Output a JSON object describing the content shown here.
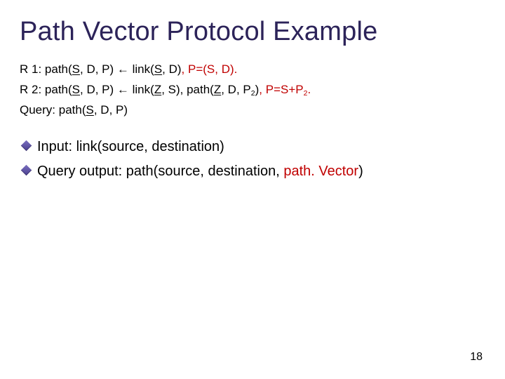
{
  "title": "Path Vector Protocol Example",
  "rules": {
    "r1_label": "R 1: ",
    "r1_lhs_pre": "path(",
    "r1_lhs_S": "S",
    "r1_lhs_post": ", D, P) ",
    "arrow": "←",
    "r1_rhs_pre": " link(",
    "r1_rhs_S": "S",
    "r1_rhs_mid": ", D)",
    "r1_red": ", P=(S, D).",
    "r2_label": "R 2: ",
    "r2_lhs_pre": "path(",
    "r2_lhs_S": "S",
    "r2_lhs_post": ", D, P) ",
    "r2_rhs_pre": " link(",
    "r2_rhs_Z1": "Z",
    "r2_rhs_mid1": ", S), path(",
    "r2_rhs_Z2": "Z",
    "r2_rhs_mid2": ", D, P",
    "r2_sub": "2",
    "r2_rhs_close": ")",
    "r2_red_a": ", P=S+P",
    "r2_red_sub": "2",
    "r2_red_b": ".",
    "q_label": "Query: ",
    "q_pre": "path(",
    "q_S": "S",
    "q_post": ", D, P)"
  },
  "bullets": {
    "b1": "Input: link(source, destination)",
    "b2_a": "Query output: path(source, destination, ",
    "b2_red": "path. Vector",
    "b2_b": ")"
  },
  "page_number": "18"
}
